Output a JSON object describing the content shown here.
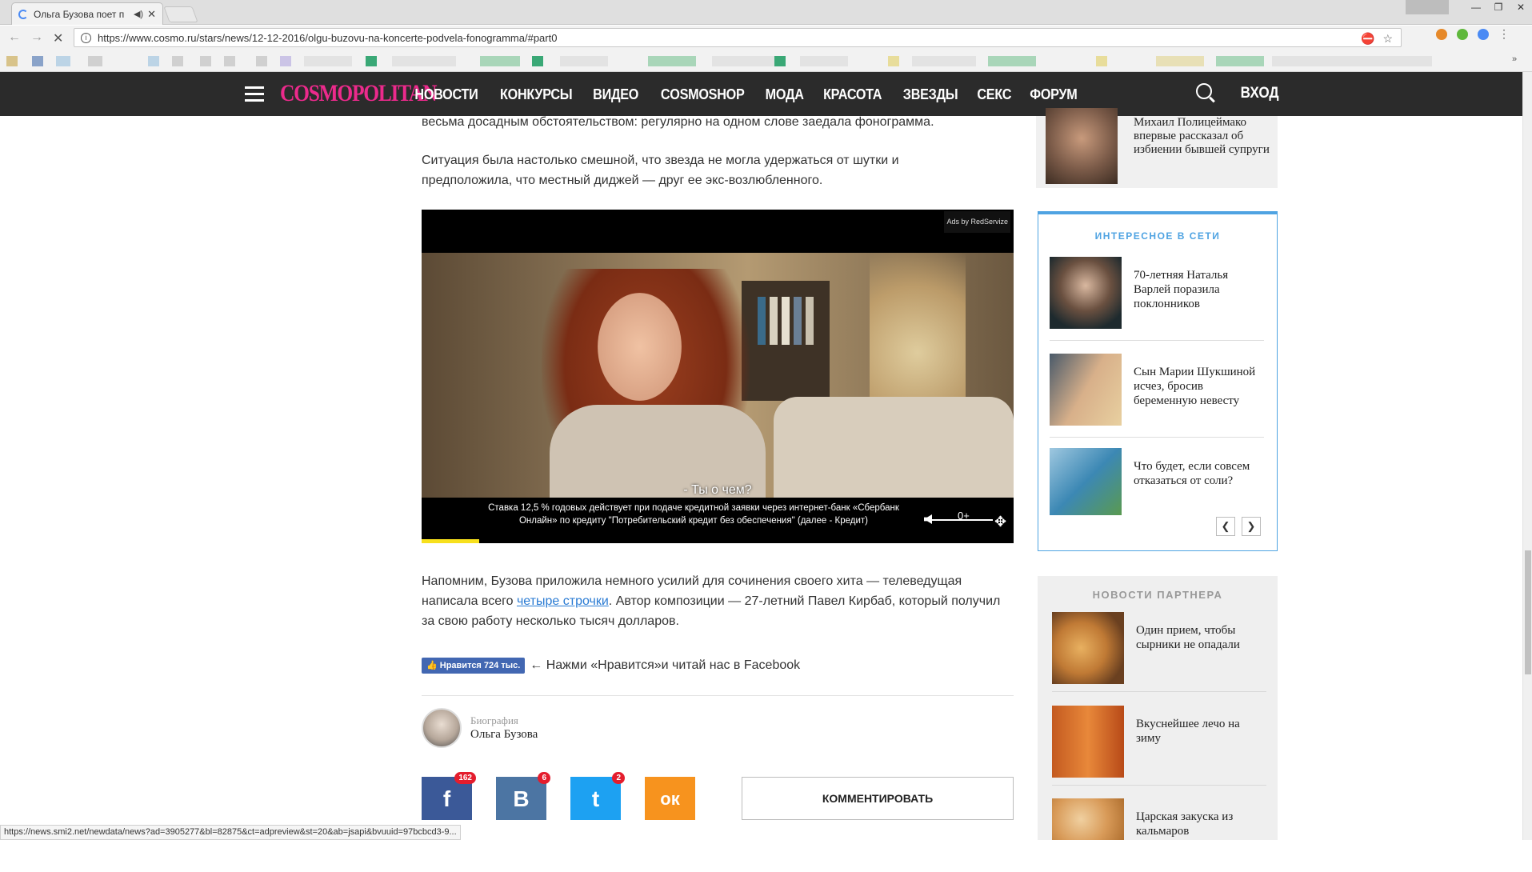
{
  "browser": {
    "tab_title": "Ольга Бузова поет п",
    "url": "https://www.cosmo.ru/stars/news/12-12-2016/olgu-buzovu-na-koncerte-podvela-fonogramma/#part0",
    "status_url": "https://news.smi2.net/newdata/news?ad=3905277&bl=82875&ct=adpreview&st=20&ab=jsapi&bvuuid=97bcbcd3-9..."
  },
  "site": {
    "logo": "COSMOPOLITAN",
    "menu": [
      "НОВОСТИ",
      "КОНКУРСЫ",
      "ВИДЕО",
      "COSMOSHOP",
      "МОДА",
      "КРАСОТА",
      "ЗВЕЗДЫ",
      "СЕКС",
      "ФОРУМ"
    ],
    "login": "ВХОД",
    "accent": "#ec2a8c"
  },
  "article": {
    "p1": "весьма досадным обстоятельством: регулярно на одном слове заедала фонограмма.",
    "p2": "Ситуация была настолько смешной, что звезда не могла удержаться от шутки и предположила, что местный диджей — друг ее экс-возлюбленного.",
    "video": {
      "ads_label": "Ads by RedServize",
      "subtitle": "- Ты о чем?",
      "disclaimer": "Ставка 12,5 % годовых действует при подаче кредитной заявки через интернет-банк «Сбербанк Онлайн» по кредиту \"Потребительский кредит без обеспечения\" (далее - Кредит)",
      "age": "0+"
    },
    "p3_before": "Напомним, Бузова приложила немного усилий для сочинения своего хита — телеведущая написала всего ",
    "p3_link": "четыре строчки",
    "p3_after": ". Автор композиции — 27-летний Павел Кирбаб, который получил за свою работу несколько тысяч долларов.",
    "fb_like": "Нравится 724 тыс.",
    "fb_text": "← Нажми «Нравится»и читай нас в Facebook",
    "bio_label": "Биография",
    "bio_name": "Ольга Бузова",
    "shares": [
      {
        "icon": "facebook-icon",
        "glyph": "f",
        "count": "162",
        "color": "#3b5998"
      },
      {
        "icon": "vk-icon",
        "glyph": "В",
        "count": "6",
        "color": "#4c75a3"
      },
      {
        "icon": "twitter-icon",
        "glyph": "t",
        "count": "2",
        "color": "#1da1f2"
      },
      {
        "icon": "odnoklassniki-icon",
        "glyph": "ок",
        "count": "",
        "color": "#f7931e"
      }
    ],
    "comment_button": "КОММЕНТИРОВАТЬ"
  },
  "sidebar": {
    "top_card": "Михаил Полицеймако впервые рассказал об избиении бывшей супруги",
    "net_title": "ИНТЕРЕСНОЕ В СЕТИ",
    "net_items": [
      "70-летняя Наталья Варлей поразила поклонников",
      "Сын Марии Шукшиной исчез, бросив беременную невесту",
      "Что будет, если совсем отказаться от соли?"
    ],
    "partner_title": "НОВОСТИ ПАРТНЕРА",
    "partner_items": [
      "Один прием, чтобы сырники не опадали",
      "Вкуснейшее лечо на зиму",
      "Царская закуска из кальмаров"
    ]
  }
}
